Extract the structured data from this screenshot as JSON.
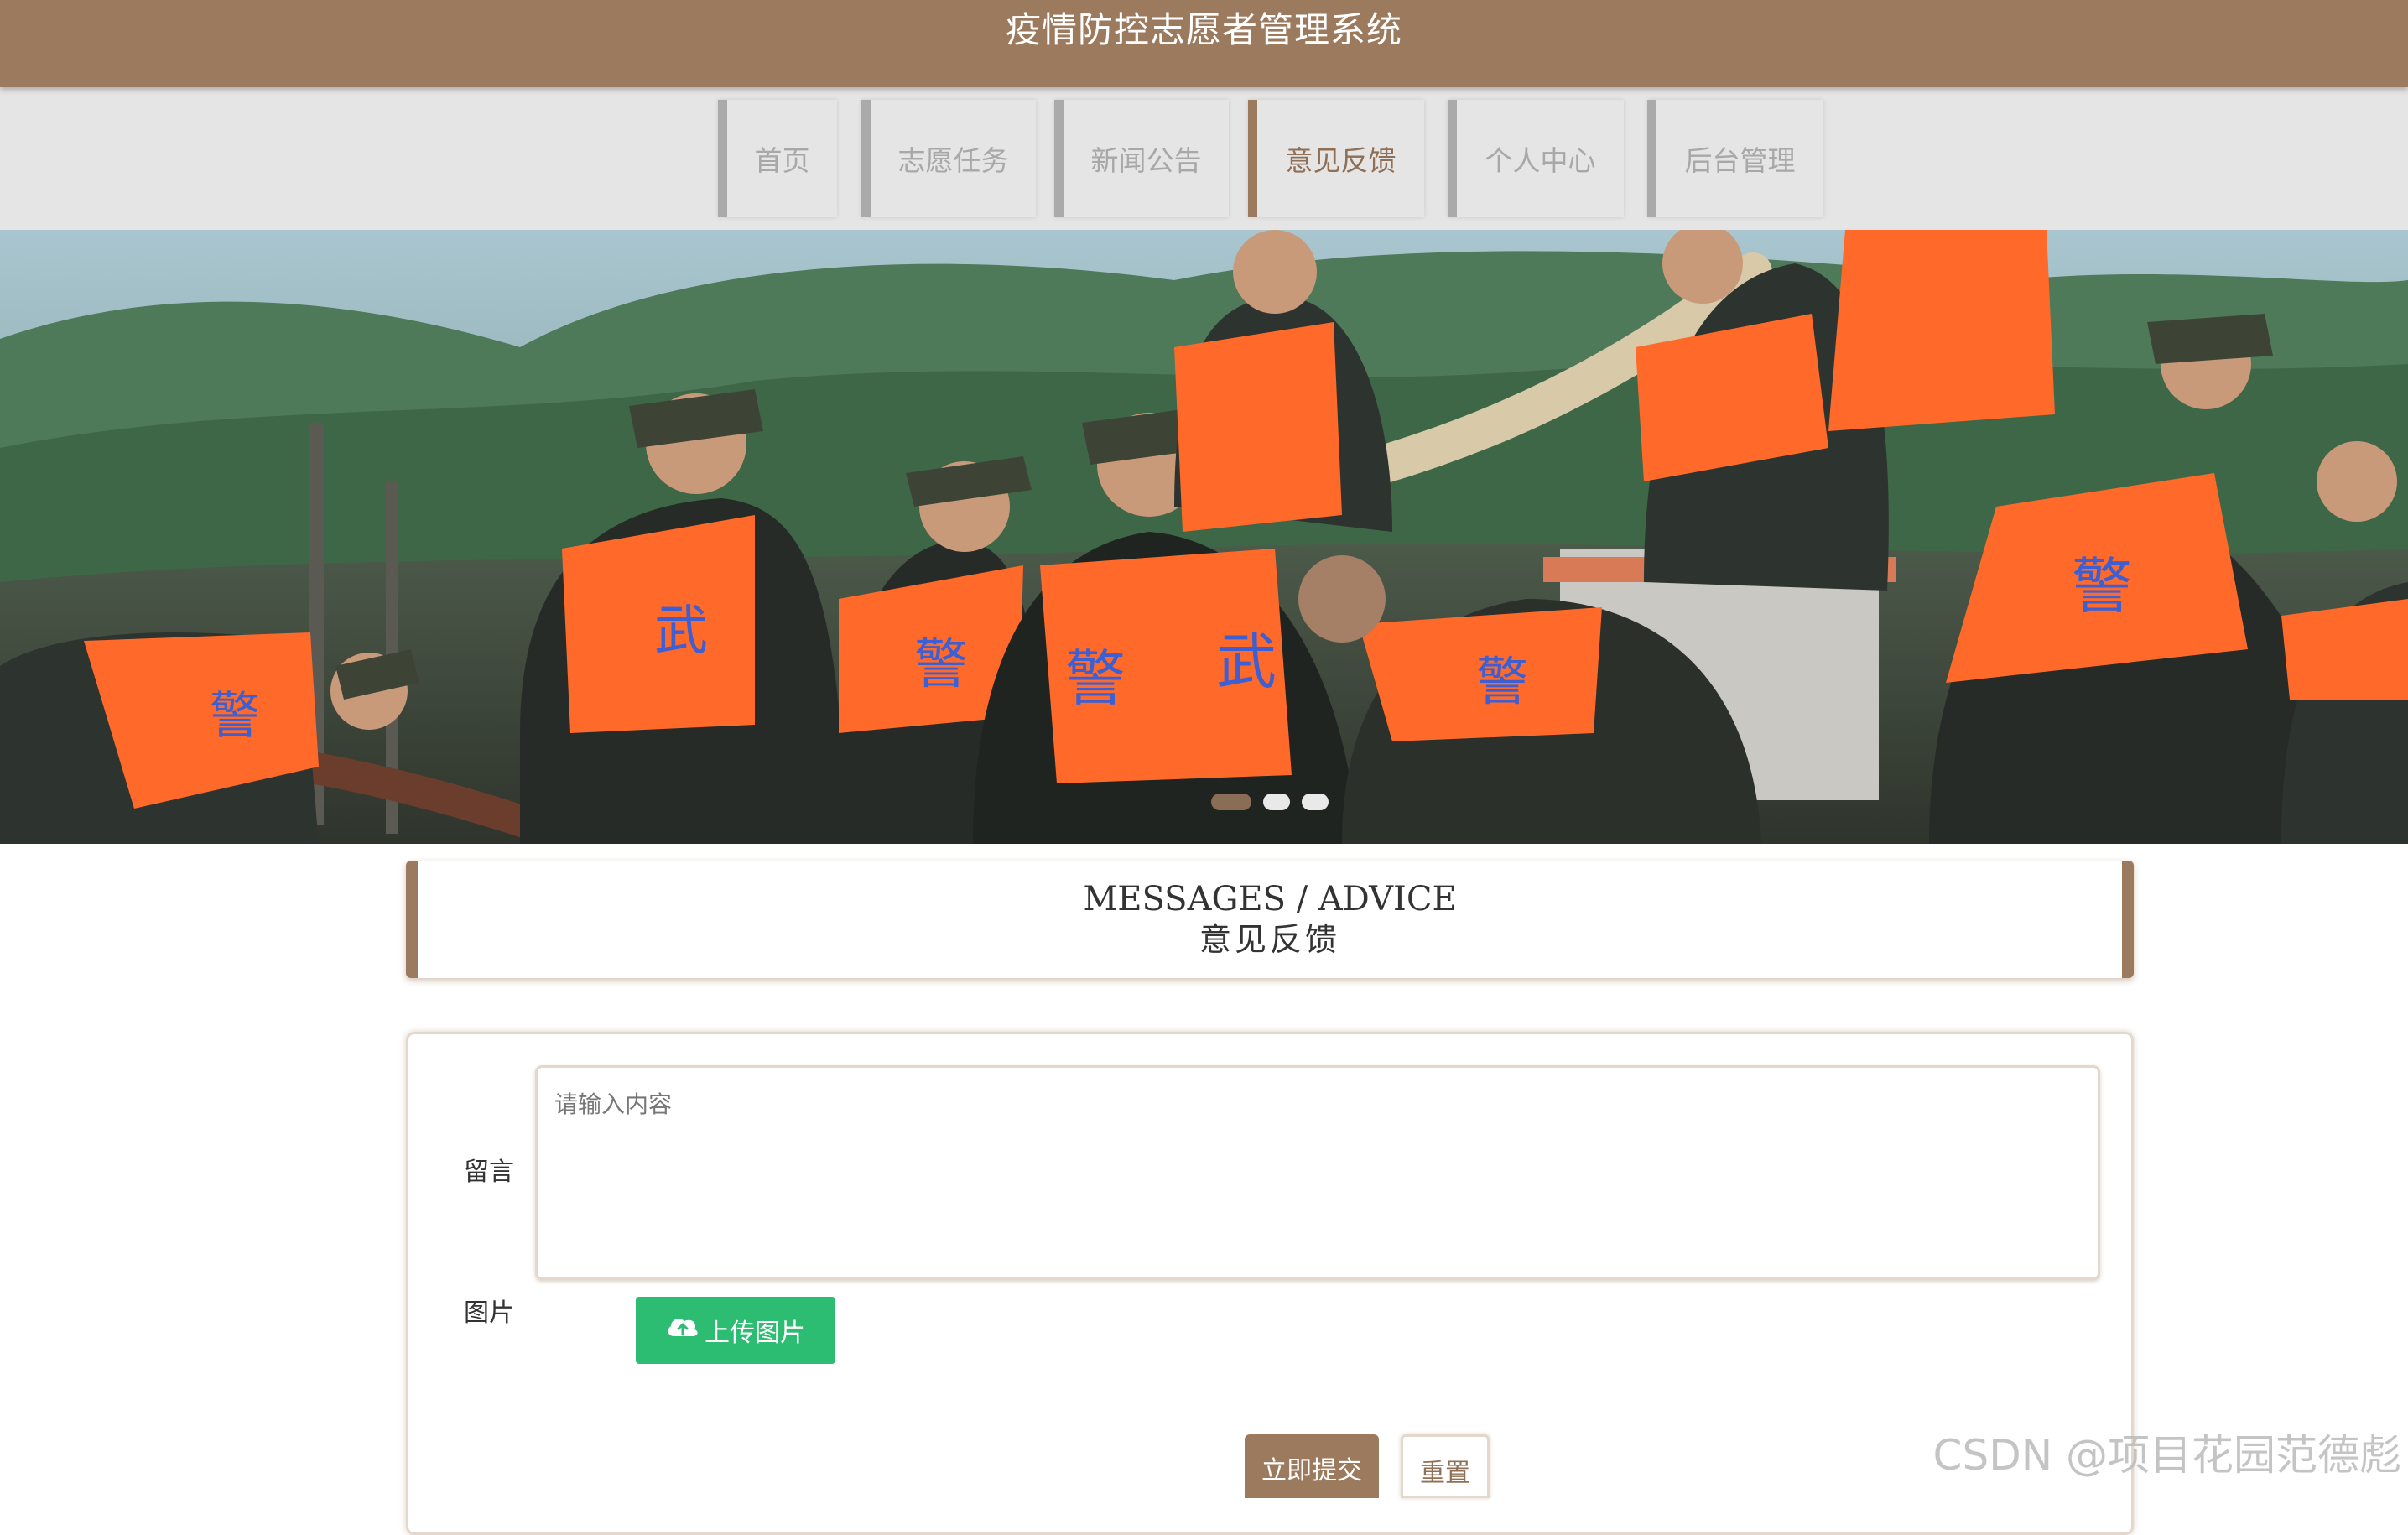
{
  "header": {
    "title": "疫情防控志愿者管理系统"
  },
  "nav": {
    "items": [
      {
        "label": "首页",
        "active": false
      },
      {
        "label": "志愿任务",
        "active": false
      },
      {
        "label": "新闻公告",
        "active": false
      },
      {
        "label": "意见反馈",
        "active": true
      },
      {
        "label": "个人中心",
        "active": false
      },
      {
        "label": "后台管理",
        "active": false
      }
    ]
  },
  "carousel": {
    "slide_count": 3,
    "active_index": 0,
    "vest_text": [
      "警",
      "武",
      "警",
      "警",
      "武",
      "警",
      "警"
    ]
  },
  "section": {
    "title_en": "MESSAGES / ADVICE",
    "title_cn": "意见反馈"
  },
  "form": {
    "message_label": "留言",
    "message_placeholder": "请输入内容",
    "message_value": "",
    "image_label": "图片",
    "upload_label": "上传图片",
    "upload_icon": "cloud-upload-icon",
    "submit_label": "立即提交",
    "reset_label": "重置"
  },
  "watermark": "CSDN @项目花园范德彪",
  "colors": {
    "brand": "#9c7a5e",
    "nav_bg": "#e5e5e5",
    "upload": "#2dbd72",
    "nav_inactive_border": "#aaaaaa"
  }
}
